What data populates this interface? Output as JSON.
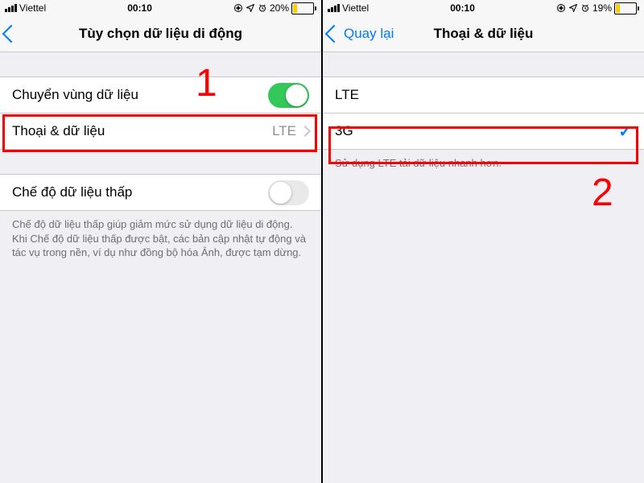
{
  "left": {
    "status": {
      "carrier": "Viettel",
      "time": "00:10",
      "battery_pct": "20%",
      "battery_fill": 20
    },
    "nav": {
      "title": "Tùy chọn dữ liệu di động",
      "back_label": ""
    },
    "rows": {
      "roaming": {
        "label": "Chuyển vùng dữ liệu",
        "on": true
      },
      "voice_data": {
        "label": "Thoại & dữ liệu",
        "value": "LTE"
      },
      "low_data": {
        "label": "Chế độ dữ liệu thấp",
        "on": false
      }
    },
    "footer": "Chế độ dữ liệu thấp giúp giảm mức sử dụng dữ liệu di động. Khi Chế độ dữ liệu thấp được bật, các bản cập nhật tự động và tác vụ trong nền, ví dụ như đồng bộ hóa Ảnh, được tạm dừng."
  },
  "right": {
    "status": {
      "carrier": "Viettel",
      "time": "00:10",
      "battery_pct": "19%",
      "battery_fill": 19
    },
    "nav": {
      "title": "Thoại & dữ liệu",
      "back_label": "Quay lại"
    },
    "options": {
      "lte": "LTE",
      "g3": "3G",
      "selected": "3G"
    },
    "footer": "Sử dụng LTE tải dữ liệu nhanh hơn."
  },
  "annotations": {
    "num1": "1",
    "num2": "2"
  }
}
